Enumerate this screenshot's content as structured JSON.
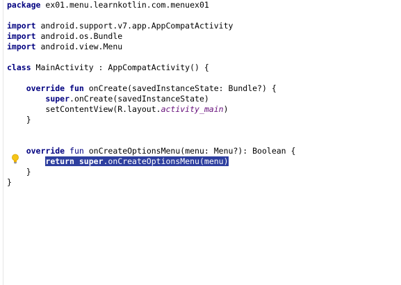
{
  "editor": {
    "lines": [
      [
        "package ex01.menu.learnkotlin.com.menuex01"
      ],
      [
        ""
      ],
      [
        "import android.support.v7.app.AppCompatActivity"
      ],
      [
        "import android.os.Bundle"
      ],
      [
        "import android.view.Menu"
      ],
      [
        ""
      ],
      [
        "class MainActivity : AppCompatActivity() {"
      ],
      [
        ""
      ],
      [
        "    override fun onCreate(savedInstanceState: Bundle?) {"
      ],
      [
        "        super.onCreate(savedInstanceState)"
      ],
      [
        "        setContentView(R.layout.activity_main)"
      ],
      [
        "    }"
      ],
      [
        ""
      ],
      [
        ""
      ],
      [
        "    override fun onCreateOptionsMenu(menu: Menu?): Boolean {"
      ],
      [
        "        return super.onCreateOptionsMenu(menu)"
      ],
      [
        "    }"
      ],
      [
        "}"
      ]
    ],
    "tokens": {
      "pkg_kw": "package",
      "pkg_name": " ex01.menu.learnkotlin.com.menuex01",
      "import_kw": "import",
      "import1": " android.support.v7.app.AppCompatActivity",
      "import2": " android.os.Bundle",
      "import3": " android.view.Menu",
      "class_kw": "class",
      "class_rest": " MainActivity : AppCompatActivity() {",
      "indent4": "    ",
      "indent8": "        ",
      "override_kw": "override",
      "fun_kw": "fun",
      "oncreate_sig": " onCreate(savedInstanceState: Bundle?) {",
      "super_kw": "super",
      "oncreate_call": ".onCreate(savedInstanceState)",
      "setcontent_prefix": "setContentView(R.layout.",
      "activity_main": "activity_main",
      "close_paren": ")",
      "close_brace_indent": "    }",
      "oncreateoptions_sig": " onCreateOptionsMenu(menu: Menu?): Boolean {",
      "return_kw": "return",
      "super_kw2": "super",
      "options_call": ".onCreateOptionsMenu(menu)",
      "close_brace": "}"
    }
  },
  "colors": {
    "keyword": "#000080",
    "selection": "#2e3f9f",
    "resource_ref": "#660e7a"
  },
  "icons": {
    "intention": "lightbulb-icon"
  }
}
